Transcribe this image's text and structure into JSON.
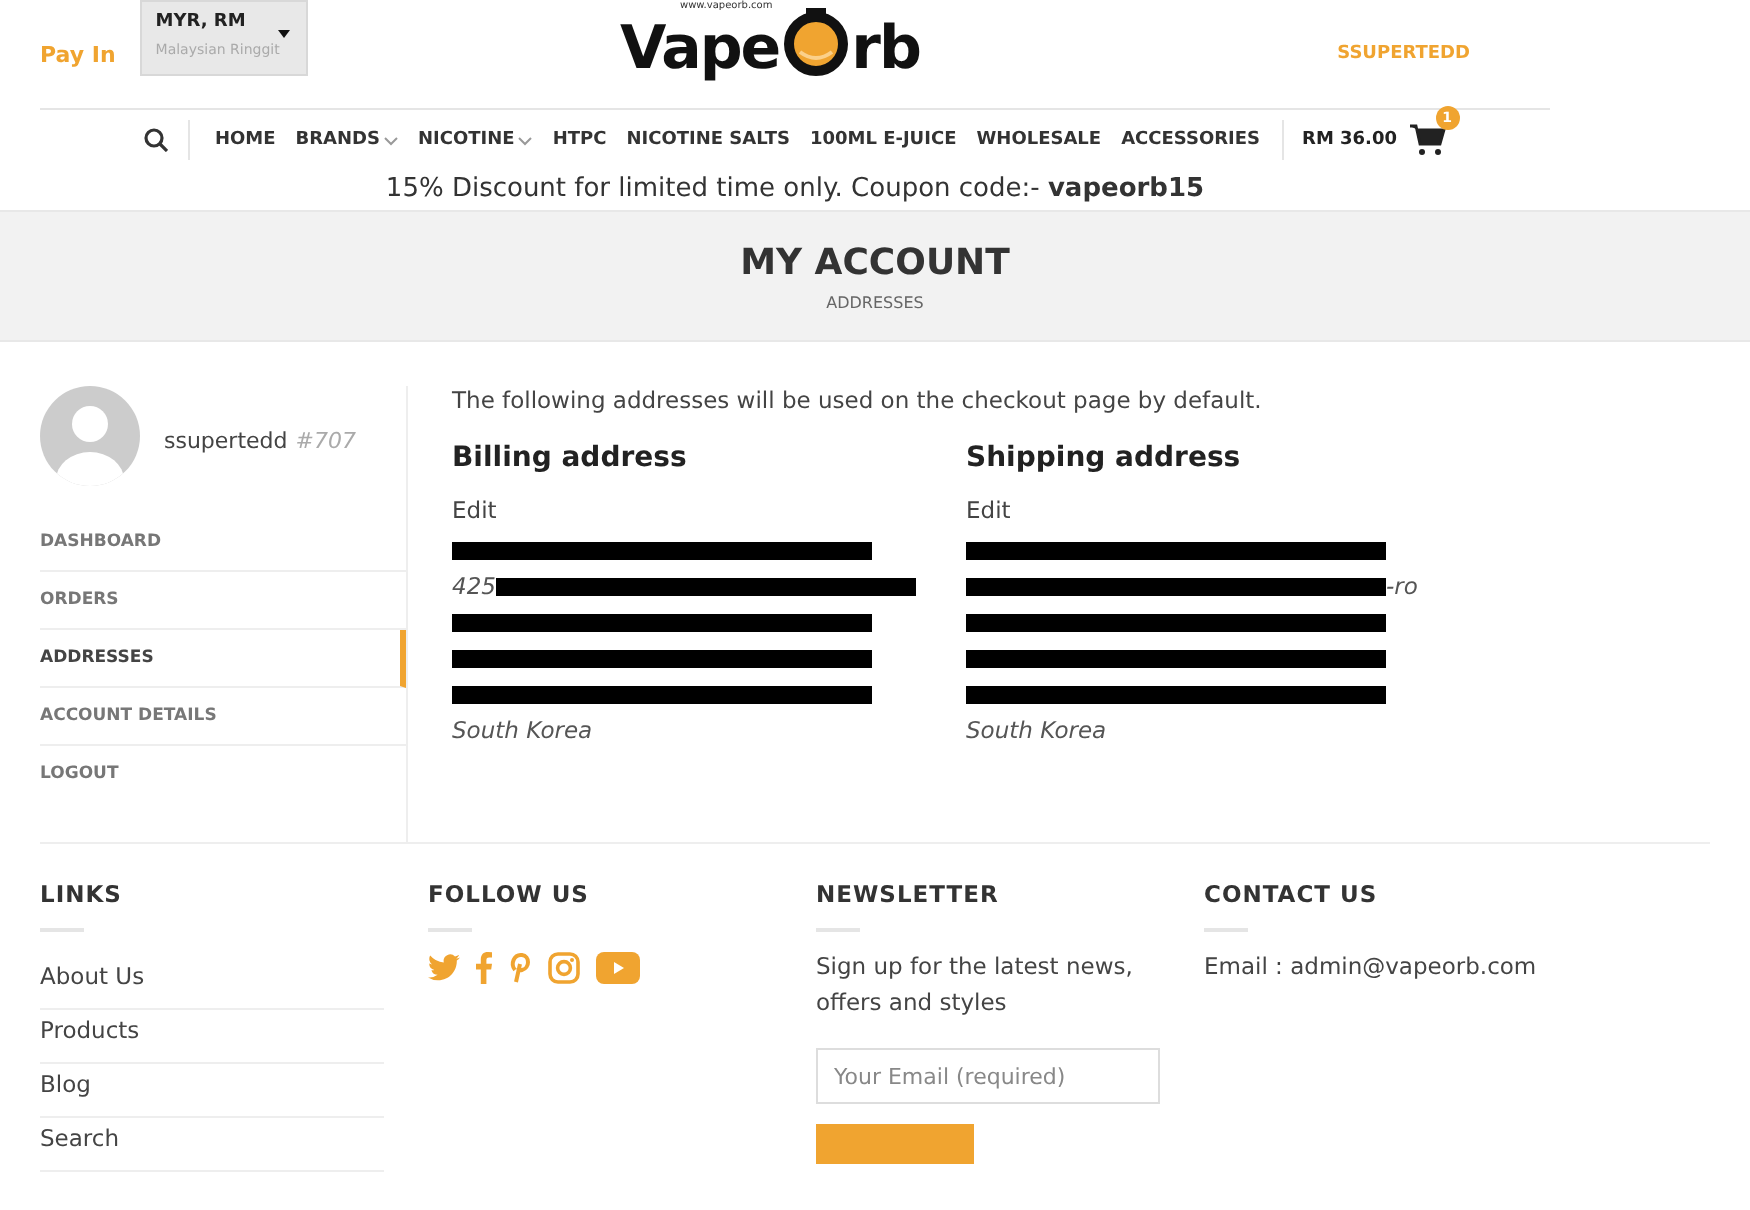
{
  "header": {
    "pay_in": "Pay In",
    "currency": {
      "code": "MYR, RM",
      "name": "Malaysian Ringgit"
    },
    "logo": {
      "before": "Vape",
      "after": "rb",
      "url": "www.vapeorb.com"
    },
    "account": "SSUPERTEDD"
  },
  "nav": {
    "items": [
      {
        "label": "HOME",
        "dropdown": false
      },
      {
        "label": "BRANDS",
        "dropdown": true
      },
      {
        "label": "NICOTINE",
        "dropdown": true
      },
      {
        "label": "HTPC",
        "dropdown": false
      },
      {
        "label": "NICOTINE SALTS",
        "dropdown": false
      },
      {
        "label": "100ML E-JUICE",
        "dropdown": false
      },
      {
        "label": "WHOLESALE",
        "dropdown": false
      },
      {
        "label": "ACCESSORIES",
        "dropdown": false
      }
    ],
    "cart_total": "RM 36.00",
    "cart_count": "1"
  },
  "promo": "15% Discount for limited time only. Coupon code:- **vapeorb15**",
  "page_title": {
    "title": "MY ACCOUNT",
    "subtitle": "ADDRESSES"
  },
  "sidebar": {
    "username": "ssupertedd",
    "user_id": "#707",
    "items": [
      {
        "label": "DASHBOARD",
        "selected": false
      },
      {
        "label": "ORDERS",
        "selected": false
      },
      {
        "label": "ADDRESSES",
        "selected": true
      },
      {
        "label": "ACCOUNT DETAILS",
        "selected": false
      },
      {
        "label": "LOGOUT",
        "selected": false
      }
    ]
  },
  "intro": "The following addresses will be used on the checkout page by default.",
  "addresses": [
    {
      "title": "Billing address",
      "edit": "Edit",
      "lines": [
        {
          "redacted": true
        },
        {
          "redacted": true,
          "before": "425"
        },
        {
          "redacted": true
        },
        {
          "redacted": true
        },
        {
          "redacted": true
        },
        {
          "redacted": false,
          "after": "South Korea"
        }
      ]
    },
    {
      "title": "Shipping address",
      "edit": "Edit",
      "lines": [
        {
          "redacted": true
        },
        {
          "redacted": true,
          "after": "-ro"
        },
        {
          "redacted": true
        },
        {
          "redacted": true
        },
        {
          "redacted": true
        },
        {
          "redacted": false,
          "after": "South Korea"
        }
      ]
    }
  ],
  "footer": {
    "links": {
      "title": "LINKS",
      "items": [
        "About Us",
        "Products",
        "Blog",
        "Search"
      ]
    },
    "follow": {
      "title": "FOLLOW US",
      "icons": [
        {
          "kind": "twitter"
        },
        {
          "kind": "facebook"
        },
        {
          "kind": "pinterest"
        },
        {
          "kind": "instagram"
        },
        {
          "kind": "youtube"
        }
      ]
    },
    "newsletter": {
      "title": "NEWSLETTER",
      "text": "Sign up for the latest news, offers and styles",
      "placeholder": "Your Email (required)"
    },
    "contact": {
      "title": "CONTACT US",
      "text": "Email : admin@vapeorb.com"
    }
  }
}
